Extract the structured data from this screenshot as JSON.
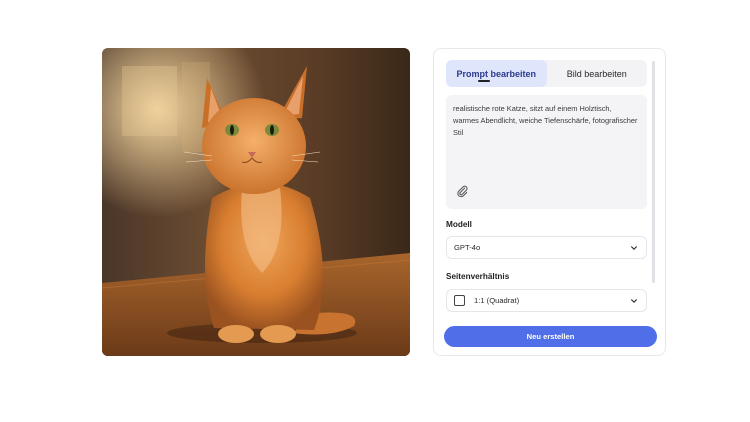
{
  "image": {
    "subject": "Orange tabby cat sitting on a wooden table"
  },
  "tabs": [
    {
      "label": "Prompt bearbeiten",
      "active": true
    },
    {
      "label": "Bild bearbeiten",
      "active": false
    }
  ],
  "prompt": {
    "text": "realistische rote Katze, sitzt auf einem Holztisch, warmes Abendlicht, weiche Tiefenschärfe, fotografischer Stil",
    "attach_icon": "paperclip-icon"
  },
  "model": {
    "label": "Modell",
    "value": "GPT-4o",
    "icon": "chevron-down-icon"
  },
  "aspect": {
    "label": "Seitenverhältnis",
    "value": "1:1 (Quadrat)",
    "icon": "square-icon"
  },
  "actions": {
    "create_label": "Neu erstellen"
  },
  "colors": {
    "accent": "#4f6ee8",
    "tab_active_bg": "#dfe6fb",
    "prompt_bg": "#f4f4f6"
  }
}
